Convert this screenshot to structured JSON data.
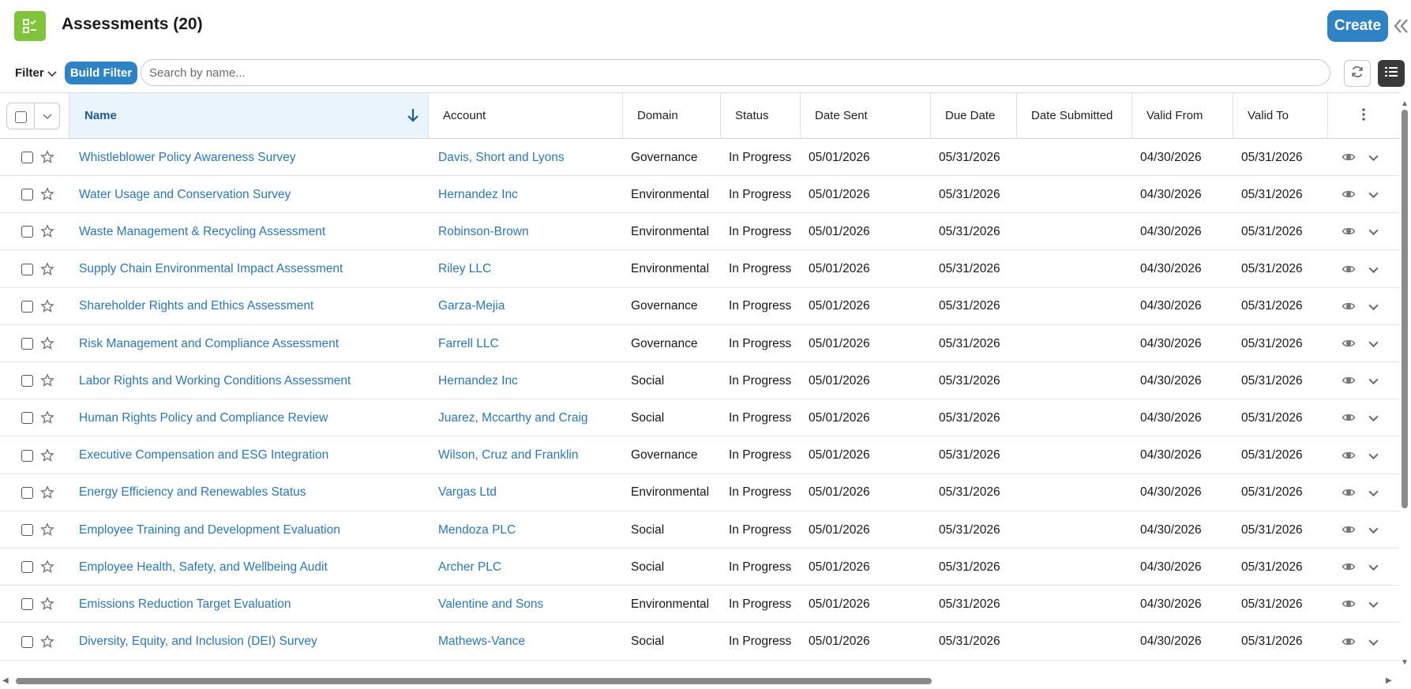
{
  "header": {
    "title": "Assessments (20)",
    "create_label": "Create",
    "app_icon": "checklist-icon",
    "collapse_icon": "double-chevron-left-icon"
  },
  "filterbar": {
    "filter_label": "Filter",
    "build_filter_label": "Build Filter",
    "search_placeholder": "Search by name..."
  },
  "colors": {
    "accent": "#2e83c5",
    "link": "#2a77b8",
    "app_icon_bg": "#7fc43a",
    "sorted_header_bg": "#eaf4fd"
  },
  "table": {
    "sorted_column": "Name",
    "sort_direction": "descending",
    "columns": [
      "Name",
      "Account",
      "Domain",
      "Status",
      "Date Sent",
      "Due Date",
      "Date Submitted",
      "Valid From",
      "Valid To"
    ],
    "rows": [
      {
        "name": "Whistleblower Policy Awareness Survey",
        "account": "Davis, Short and Lyons",
        "domain": "Governance",
        "status": "In Progress",
        "date_sent": "05/01/2026",
        "due_date": "05/31/2026",
        "date_submitted": "",
        "valid_from": "04/30/2026",
        "valid_to": "05/31/2026"
      },
      {
        "name": "Water Usage and Conservation Survey",
        "account": "Hernandez Inc",
        "domain": "Environmental",
        "status": "In Progress",
        "date_sent": "05/01/2026",
        "due_date": "05/31/2026",
        "date_submitted": "",
        "valid_from": "04/30/2026",
        "valid_to": "05/31/2026"
      },
      {
        "name": "Waste Management & Recycling Assessment",
        "account": "Robinson-Brown",
        "domain": "Environmental",
        "status": "In Progress",
        "date_sent": "05/01/2026",
        "due_date": "05/31/2026",
        "date_submitted": "",
        "valid_from": "04/30/2026",
        "valid_to": "05/31/2026"
      },
      {
        "name": "Supply Chain Environmental Impact Assessment",
        "account": "Riley LLC",
        "domain": "Environmental",
        "status": "In Progress",
        "date_sent": "05/01/2026",
        "due_date": "05/31/2026",
        "date_submitted": "",
        "valid_from": "04/30/2026",
        "valid_to": "05/31/2026"
      },
      {
        "name": "Shareholder Rights and Ethics Assessment",
        "account": "Garza-Mejia",
        "domain": "Governance",
        "status": "In Progress",
        "date_sent": "05/01/2026",
        "due_date": "05/31/2026",
        "date_submitted": "",
        "valid_from": "04/30/2026",
        "valid_to": "05/31/2026"
      },
      {
        "name": "Risk Management and Compliance Assessment",
        "account": "Farrell LLC",
        "domain": "Governance",
        "status": "In Progress",
        "date_sent": "05/01/2026",
        "due_date": "05/31/2026",
        "date_submitted": "",
        "valid_from": "04/30/2026",
        "valid_to": "05/31/2026"
      },
      {
        "name": "Labor Rights and Working Conditions Assessment",
        "account": "Hernandez Inc",
        "domain": "Social",
        "status": "In Progress",
        "date_sent": "05/01/2026",
        "due_date": "05/31/2026",
        "date_submitted": "",
        "valid_from": "04/30/2026",
        "valid_to": "05/31/2026"
      },
      {
        "name": "Human Rights Policy and Compliance Review",
        "account": "Juarez, Mccarthy and Craig",
        "domain": "Social",
        "status": "In Progress",
        "date_sent": "05/01/2026",
        "due_date": "05/31/2026",
        "date_submitted": "",
        "valid_from": "04/30/2026",
        "valid_to": "05/31/2026"
      },
      {
        "name": "Executive Compensation and ESG Integration",
        "account": "Wilson, Cruz and Franklin",
        "domain": "Governance",
        "status": "In Progress",
        "date_sent": "05/01/2026",
        "due_date": "05/31/2026",
        "date_submitted": "",
        "valid_from": "04/30/2026",
        "valid_to": "05/31/2026"
      },
      {
        "name": "Energy Efficiency and Renewables Status",
        "account": "Vargas Ltd",
        "domain": "Environmental",
        "status": "In Progress",
        "date_sent": "05/01/2026",
        "due_date": "05/31/2026",
        "date_submitted": "",
        "valid_from": "04/30/2026",
        "valid_to": "05/31/2026"
      },
      {
        "name": "Employee Training and Development Evaluation",
        "account": "Mendoza PLC",
        "domain": "Social",
        "status": "In Progress",
        "date_sent": "05/01/2026",
        "due_date": "05/31/2026",
        "date_submitted": "",
        "valid_from": "04/30/2026",
        "valid_to": "05/31/2026"
      },
      {
        "name": "Employee Health, Safety, and Wellbeing Audit",
        "account": "Archer PLC",
        "domain": "Social",
        "status": "In Progress",
        "date_sent": "05/01/2026",
        "due_date": "05/31/2026",
        "date_submitted": "",
        "valid_from": "04/30/2026",
        "valid_to": "05/31/2026"
      },
      {
        "name": "Emissions Reduction Target Evaluation",
        "account": "Valentine and Sons",
        "domain": "Environmental",
        "status": "In Progress",
        "date_sent": "05/01/2026",
        "due_date": "05/31/2026",
        "date_submitted": "",
        "valid_from": "04/30/2026",
        "valid_to": "05/31/2026"
      },
      {
        "name": "Diversity, Equity, and Inclusion (DEI) Survey",
        "account": "Mathews-Vance",
        "domain": "Social",
        "status": "In Progress",
        "date_sent": "05/01/2026",
        "due_date": "05/31/2026",
        "date_submitted": "",
        "valid_from": "04/30/2026",
        "valid_to": "05/31/2026"
      }
    ]
  }
}
